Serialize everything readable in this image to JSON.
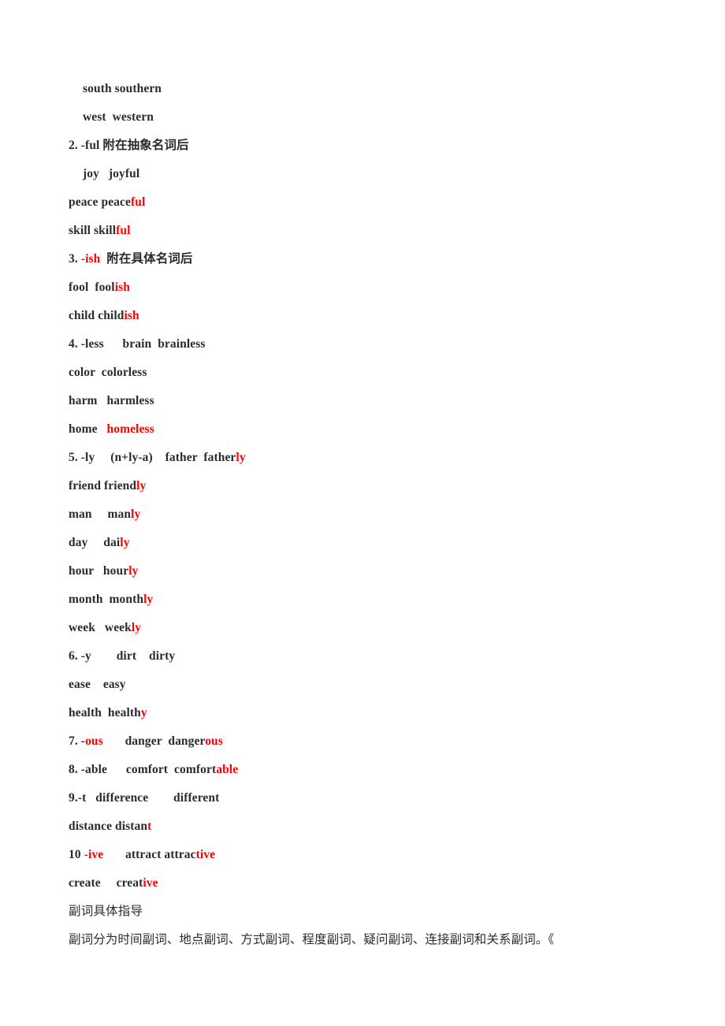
{
  "document": {
    "page_background": "#ffffff",
    "text_color": "#2b2b2b",
    "accent_color": "#ff0000",
    "lines": [
      {
        "id": "line-south-southern",
        "indent": true,
        "style": "en",
        "segments": [
          {
            "text": "south southern",
            "color": "black"
          }
        ]
      },
      {
        "id": "line-west-western",
        "indent": true,
        "style": "en",
        "segments": [
          {
            "text": "west  western",
            "color": "black"
          }
        ]
      },
      {
        "id": "line-item-2-ful",
        "indent": false,
        "style": "en",
        "segments": [
          {
            "text": "2. -ful 附在抽象名词后",
            "color": "black"
          }
        ]
      },
      {
        "id": "line-joy-joyful",
        "indent": true,
        "style": "en",
        "segments": [
          {
            "text": "joy   joyful",
            "color": "black"
          }
        ]
      },
      {
        "id": "line-peace-peaceful",
        "indent": false,
        "style": "en",
        "segments": [
          {
            "text": "peace peace",
            "color": "black"
          },
          {
            "text": "ful",
            "color": "red"
          }
        ]
      },
      {
        "id": "line-skill-skillful",
        "indent": false,
        "style": "en",
        "segments": [
          {
            "text": "skill skill",
            "color": "black"
          },
          {
            "text": "ful",
            "color": "red"
          }
        ]
      },
      {
        "id": "line-item-3-ish",
        "indent": false,
        "style": "en",
        "segments": [
          {
            "text": "3. ",
            "color": "black"
          },
          {
            "text": "-ish",
            "color": "red"
          },
          {
            "text": "  附在具体名词后",
            "color": "black"
          }
        ]
      },
      {
        "id": "line-fool-foolish",
        "indent": false,
        "style": "en",
        "segments": [
          {
            "text": "fool  fool",
            "color": "black"
          },
          {
            "text": "ish",
            "color": "red"
          }
        ]
      },
      {
        "id": "line-child-childish",
        "indent": false,
        "style": "en",
        "segments": [
          {
            "text": "child child",
            "color": "black"
          },
          {
            "text": "ish",
            "color": "red"
          }
        ]
      },
      {
        "id": "line-item-4-less",
        "indent": false,
        "style": "en",
        "segments": [
          {
            "text": "4. -less      brain  brainless",
            "color": "black"
          }
        ]
      },
      {
        "id": "line-color-colorless",
        "indent": false,
        "style": "en",
        "segments": [
          {
            "text": "color  colorless",
            "color": "black"
          }
        ]
      },
      {
        "id": "line-harm-harmless",
        "indent": false,
        "style": "en",
        "segments": [
          {
            "text": "harm   harmless",
            "color": "black"
          }
        ]
      },
      {
        "id": "line-home-homeless",
        "indent": false,
        "style": "en",
        "segments": [
          {
            "text": "home   ",
            "color": "black"
          },
          {
            "text": "homeless",
            "color": "red"
          }
        ]
      },
      {
        "id": "line-item-5-ly",
        "indent": false,
        "style": "en",
        "segments": [
          {
            "text": "5. -ly     (n+ly-a)    father  father",
            "color": "black"
          },
          {
            "text": "ly",
            "color": "red"
          }
        ]
      },
      {
        "id": "line-friend-friendly",
        "indent": false,
        "style": "en",
        "segments": [
          {
            "text": "friend friend",
            "color": "black"
          },
          {
            "text": "ly",
            "color": "red"
          }
        ]
      },
      {
        "id": "line-man-manly",
        "indent": false,
        "style": "en",
        "segments": [
          {
            "text": "man     man",
            "color": "black"
          },
          {
            "text": "ly",
            "color": "red"
          }
        ]
      },
      {
        "id": "line-day-daily",
        "indent": false,
        "style": "en",
        "segments": [
          {
            "text": "day     dai",
            "color": "black"
          },
          {
            "text": "ly",
            "color": "red"
          }
        ]
      },
      {
        "id": "line-hour-hourly",
        "indent": false,
        "style": "en",
        "segments": [
          {
            "text": "hour   hour",
            "color": "black"
          },
          {
            "text": "ly",
            "color": "red"
          }
        ]
      },
      {
        "id": "line-month-monthly",
        "indent": false,
        "style": "en",
        "segments": [
          {
            "text": "month  month",
            "color": "black"
          },
          {
            "text": "ly",
            "color": "red"
          }
        ]
      },
      {
        "id": "line-week-weekly",
        "indent": false,
        "style": "en",
        "segments": [
          {
            "text": "week   week",
            "color": "black"
          },
          {
            "text": "ly",
            "color": "red"
          }
        ]
      },
      {
        "id": "line-item-6-y",
        "indent": false,
        "style": "en",
        "segments": [
          {
            "text": "6. -y        dirt    dirty",
            "color": "black"
          }
        ]
      },
      {
        "id": "line-ease-easy",
        "indent": false,
        "style": "en",
        "segments": [
          {
            "text": "ease    easy",
            "color": "black"
          }
        ]
      },
      {
        "id": "line-health-healthy",
        "indent": false,
        "style": "en",
        "segments": [
          {
            "text": "health  health",
            "color": "black"
          },
          {
            "text": "y",
            "color": "red"
          }
        ]
      },
      {
        "id": "line-item-7-ous",
        "indent": false,
        "style": "en",
        "segments": [
          {
            "text": "7. -",
            "color": "black"
          },
          {
            "text": "ous",
            "color": "red"
          },
          {
            "text": "       danger  danger",
            "color": "black"
          },
          {
            "text": "ous",
            "color": "red"
          }
        ]
      },
      {
        "id": "line-item-8-able",
        "indent": false,
        "style": "en",
        "segments": [
          {
            "text": "8. -able      comfort  comfort",
            "color": "black"
          },
          {
            "text": "able",
            "color": "red"
          }
        ]
      },
      {
        "id": "line-item-9-t",
        "indent": false,
        "style": "en",
        "segments": [
          {
            "text": "9.-t   difference        different",
            "color": "black"
          }
        ]
      },
      {
        "id": "line-distance-distant",
        "indent": false,
        "style": "en",
        "segments": [
          {
            "text": "distance distan",
            "color": "black"
          },
          {
            "text": "t",
            "color": "red"
          }
        ]
      },
      {
        "id": "line-item-10-ive",
        "indent": false,
        "style": "en",
        "segments": [
          {
            "text": "10 ",
            "color": "black"
          },
          {
            "text": "-ive",
            "color": "red"
          },
          {
            "text": "       attract attrac",
            "color": "black"
          },
          {
            "text": "tive",
            "color": "red"
          }
        ]
      },
      {
        "id": "line-create-creative",
        "indent": false,
        "style": "en",
        "segments": [
          {
            "text": "create     creat",
            "color": "black"
          },
          {
            "text": "ive",
            "color": "red"
          }
        ]
      },
      {
        "id": "line-adverb-heading",
        "indent": false,
        "style": "cn",
        "segments": [
          {
            "text": "副词具体指导",
            "color": "black"
          }
        ]
      },
      {
        "id": "line-adverb-body",
        "indent": false,
        "style": "cn-body",
        "segments": [
          {
            "text": "副词分为时间副词、地点副词、方式副词、程度副词、疑问副词、连接副词和关系副词。《",
            "color": "black"
          }
        ]
      }
    ]
  }
}
